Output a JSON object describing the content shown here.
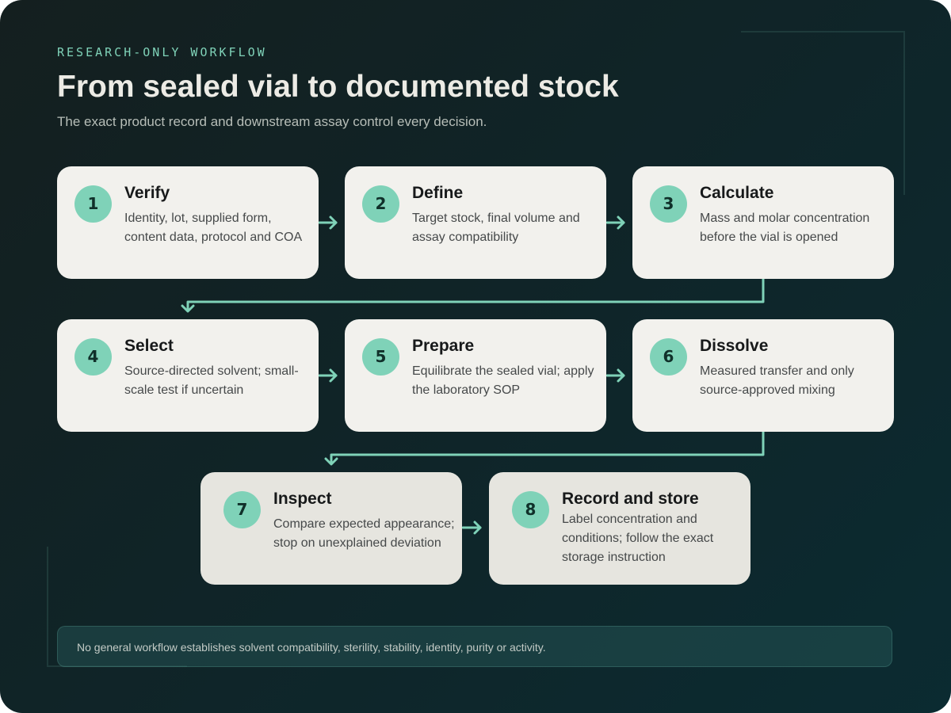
{
  "header": {
    "eyebrow": "RESEARCH-ONLY WORKFLOW",
    "title": "From sealed vial to documented stock",
    "subtitle": "The exact product record and downstream assay control every decision."
  },
  "steps": [
    {
      "number": "1",
      "title": "Verify",
      "description": "Identity, lot, supplied form, content data, protocol and COA"
    },
    {
      "number": "2",
      "title": "Define",
      "description": "Target stock, final volume and assay compatibility"
    },
    {
      "number": "3",
      "title": "Calculate",
      "description": "Mass and molar concentration before the vial is opened"
    },
    {
      "number": "4",
      "title": "Select",
      "description": "Source-directed solvent; small-scale test if uncertain"
    },
    {
      "number": "5",
      "title": "Prepare",
      "description": "Equilibrate the sealed vial; apply the laboratory SOP"
    },
    {
      "number": "6",
      "title": "Dissolve",
      "description": "Measured transfer and only source-approved mixing"
    },
    {
      "number": "7",
      "title": "Inspect",
      "description": "Compare expected appearance; stop on unexplained deviation"
    },
    {
      "number": "8",
      "title": "Record and store",
      "description": "Label concentration and conditions; follow the exact storage instruction"
    }
  ],
  "footer": {
    "note": "No general workflow establishes solvent compatibility, sterility, stability, identity, purity or activity."
  },
  "colors": {
    "accent": "#7fd2b8",
    "card": "#f2f1ed",
    "card_alt": "#e6e5df",
    "background": "#0f2529"
  }
}
